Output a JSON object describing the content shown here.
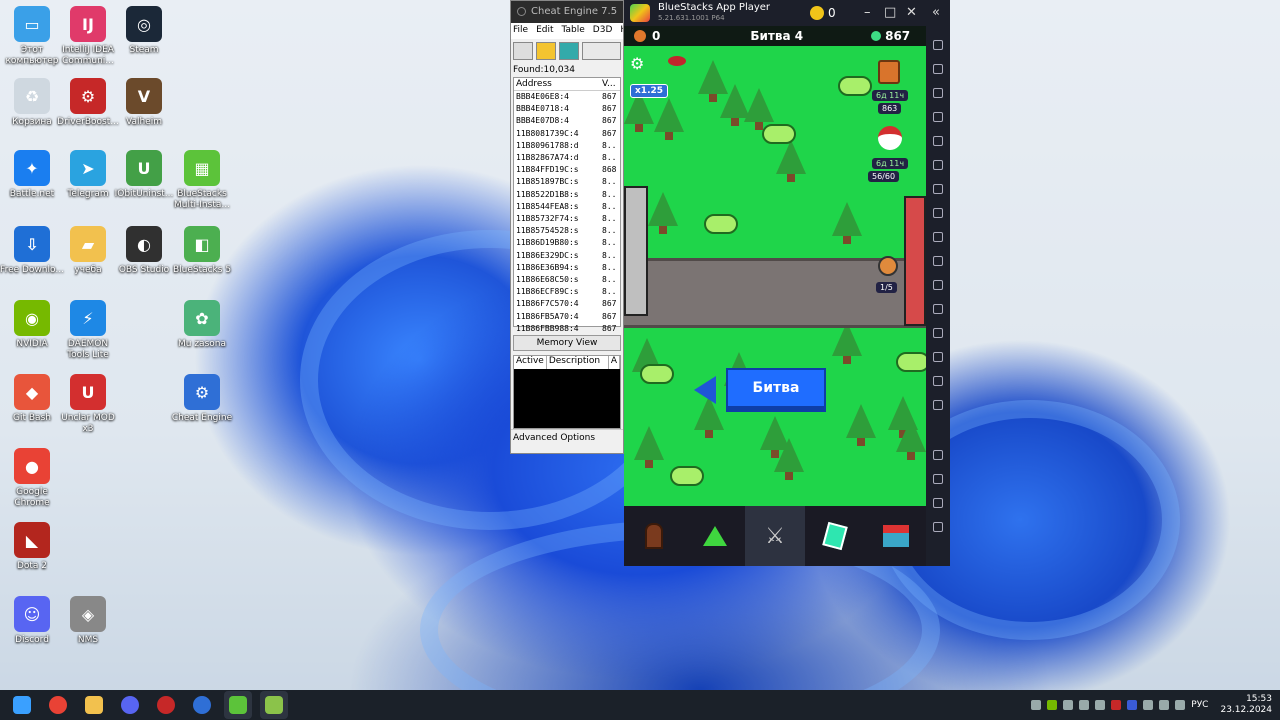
{
  "desktop": {
    "icons": [
      {
        "label": "Этот компьютер",
        "color": "#3aa0e8",
        "glyph": "▭"
      },
      {
        "label": "Корзина",
        "color": "#cfd8e0",
        "glyph": "♻"
      },
      {
        "label": "Battle.net",
        "color": "#1a7ef0",
        "glyph": "✦"
      },
      {
        "label": "Free Downlo...",
        "color": "#1f6fd6",
        "glyph": "⇩"
      },
      {
        "label": "NVIDIA",
        "color": "#76b900",
        "glyph": "◉"
      },
      {
        "label": "Git Bash",
        "color": "#e8553b",
        "glyph": "◆"
      },
      {
        "label": "Google Chrome",
        "color": "#e94235",
        "glyph": "●"
      },
      {
        "label": "Dota 2",
        "color": "#b3261e",
        "glyph": "◣"
      },
      {
        "label": "Discord",
        "color": "#5865f2",
        "glyph": "☺"
      },
      {
        "label": "IntelliJ IDEA Communi...",
        "color": "#e03a6a",
        "glyph": "IJ"
      },
      {
        "label": "DriverBoost...",
        "color": "#c62828",
        "glyph": "⚙"
      },
      {
        "label": "Telegram",
        "color": "#2aa3e0",
        "glyph": "➤"
      },
      {
        "label": "учеба",
        "color": "#f2c14e",
        "glyph": "▰"
      },
      {
        "label": "DAEMON Tools Lite",
        "color": "#1e88e5",
        "glyph": "⚡"
      },
      {
        "label": "Unclar MOD x3",
        "color": "#d32f2f",
        "glyph": "U"
      },
      {
        "label": "NMS",
        "color": "#888888",
        "glyph": "◈"
      },
      {
        "label": "Steam",
        "color": "#1b2838",
        "glyph": "◎"
      },
      {
        "label": "Valheim",
        "color": "#6b4a2b",
        "glyph": "V"
      },
      {
        "label": "IObitUninst...",
        "color": "#43a047",
        "glyph": "U"
      },
      {
        "label": "OBS Studio",
        "color": "#303030",
        "glyph": "◐"
      },
      {
        "label": "BlueStacks Multi-Insta...",
        "color": "#5cc33a",
        "glyph": "▦"
      },
      {
        "label": "BlueStacks 5",
        "color": "#4caf50",
        "glyph": "◧"
      },
      {
        "label": "Mu zasona",
        "color": "#4bb37a",
        "glyph": "✿"
      },
      {
        "label": "Cheat Engine",
        "color": "#2f6fd6",
        "glyph": "⚙"
      }
    ]
  },
  "cheat_engine": {
    "title": "Cheat Engine 7.5",
    "menu": [
      "File",
      "Edit",
      "Table",
      "D3D",
      "H"
    ],
    "found": "Found:10,034",
    "columns": [
      "Address",
      "V..."
    ],
    "rows": [
      {
        "a": "BBB4E06E8:4",
        "v": "867"
      },
      {
        "a": "BBB4E0718:4",
        "v": "867"
      },
      {
        "a": "BBB4E07D8:4",
        "v": "867"
      },
      {
        "a": "11B8081739C:4",
        "v": "867"
      },
      {
        "a": "11B80961788:d",
        "v": "8.."
      },
      {
        "a": "11B82867A74:d",
        "v": "8.."
      },
      {
        "a": "11B84FFD19C:s",
        "v": "868"
      },
      {
        "a": "11B851897BC:s",
        "v": "8.."
      },
      {
        "a": "11B8522D1B8:s",
        "v": "8.."
      },
      {
        "a": "11B8544FEA8:s",
        "v": "8.."
      },
      {
        "a": "11B85732F74:s",
        "v": "8.."
      },
      {
        "a": "11B85754528:s",
        "v": "8.."
      },
      {
        "a": "11B86D19B80:s",
        "v": "8.."
      },
      {
        "a": "11B86E329DC:s",
        "v": "8.."
      },
      {
        "a": "11B86E36B94:s",
        "v": "8.."
      },
      {
        "a": "11B86E68C50:s",
        "v": "8.."
      },
      {
        "a": "11B86ECF89C:s",
        "v": "8.."
      },
      {
        "a": "11B86F7C570:4",
        "v": "867"
      },
      {
        "a": "11B86FB5A70:4",
        "v": "867"
      },
      {
        "a": "11B86FBB988:4",
        "v": "867"
      }
    ],
    "memory_view": "Memory View",
    "cheat_columns": [
      "Active",
      "Description",
      "A"
    ],
    "advanced": "Advanced Options"
  },
  "bluestacks": {
    "title": "BlueStacks App Player",
    "version": "5.21.631.1001 P64",
    "coins": "0"
  },
  "game": {
    "left_count": "0",
    "title": "Битва 4",
    "gems": "867",
    "speed": "x1.25",
    "timer1": "6д 11ч",
    "score1": "863",
    "timer2": "6д 11ч",
    "progress2": "56/60",
    "progress3": "1/5",
    "battle_button": "Битва"
  },
  "taskbar": {
    "lang": "РУС",
    "time": "15:53",
    "date": "23.12.2024"
  }
}
